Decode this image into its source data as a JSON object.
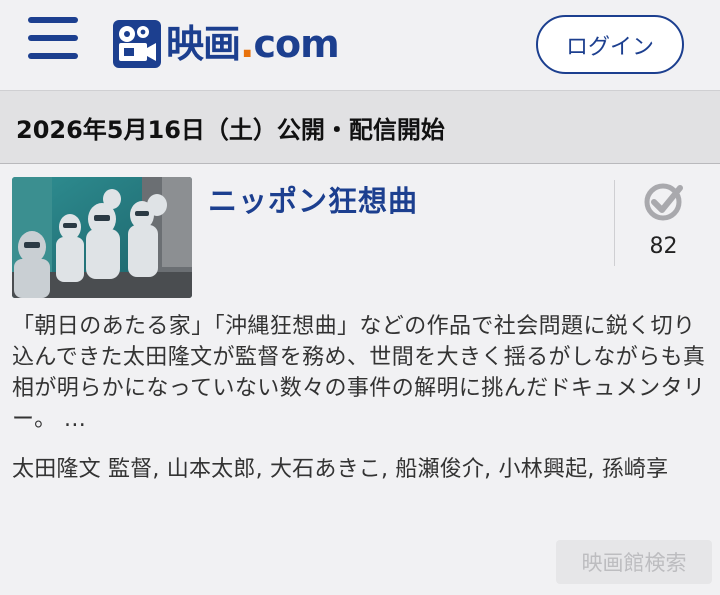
{
  "header": {
    "logo_text_main": "映画",
    "logo_text_dot": ".",
    "logo_text_tld": "com",
    "login_label": "ログイン",
    "colors": {
      "brand": "#1c3f8f",
      "accent": "#e8720c"
    }
  },
  "date_bar": {
    "text": "2026年5月16日（土）公開・配信開始"
  },
  "movie": {
    "title": "ニッポン狂想曲",
    "check_count": "82",
    "synopsis": "「朝日のあたる家」「沖縄狂想曲」などの作品で社会問題に鋭く切り込んできた太田隆文が監督を務め、世間を大きく揺るがしながらも真相が明らかになっていない数々の事件の解明に挑んだドキュメンタリー。 ...",
    "credits": "太田隆文 監督, 山本太郎, 大石あきこ, 船瀬俊介, 小林興起, 孫崎享",
    "theater_search_label": "映画館検索"
  },
  "icons": {
    "menu": "hamburger-menu-icon",
    "check": "check-circle-icon"
  }
}
